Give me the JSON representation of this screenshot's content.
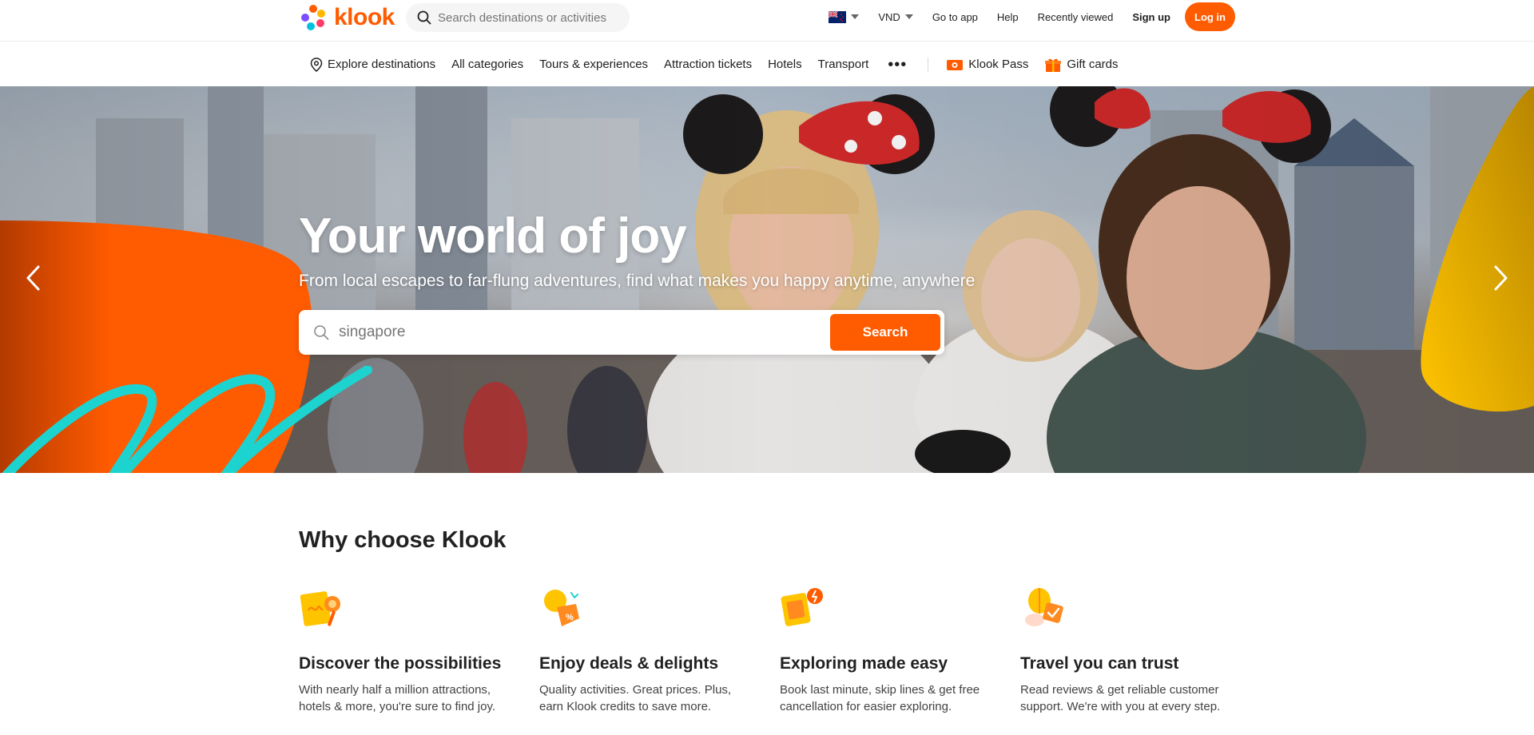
{
  "header": {
    "logo_text": "klook",
    "search_placeholder": "Search destinations or activities",
    "currency": "VND",
    "links": [
      "Go to app",
      "Help",
      "Recently viewed",
      "Sign up"
    ],
    "login_label": "Log in"
  },
  "catnav": {
    "items": [
      "Explore destinations",
      "All categories",
      "Tours & experiences",
      "Attraction tickets",
      "Hotels",
      "Transport"
    ],
    "more_label": "•••",
    "pass_label": "Klook Pass",
    "gift_label": "Gift cards"
  },
  "hero": {
    "title": "Your world of joy",
    "subtitle": "From local escapes to far-flung adventures, find what makes you happy anytime, anywhere",
    "search_value": "singapore",
    "search_button": "Search"
  },
  "why": {
    "title": "Why choose Klook",
    "features": [
      {
        "title": "Discover the possibilities",
        "desc": "With nearly half a million attractions, hotels & more, you're sure to find joy."
      },
      {
        "title": "Enjoy deals & delights",
        "desc": "Quality activities. Great prices. Plus, earn Klook credits to save more."
      },
      {
        "title": "Exploring made easy",
        "desc": "Book last minute, skip lines & get free cancellation for easier exploring."
      },
      {
        "title": "Travel you can trust",
        "desc": "Read reviews & get reliable customer support. We're with you at every step."
      }
    ]
  },
  "colors": {
    "brand": "#ff5b00",
    "text": "#212121"
  },
  "icons": [
    "klook-logo-icon",
    "search-icon",
    "nz-flag-icon",
    "location-pin-icon",
    "klook-pass-icon",
    "gift-icon",
    "arrow-left-icon",
    "arrow-right-icon",
    "possibilities-icon",
    "deals-icon",
    "easy-icon",
    "trust-icon"
  ]
}
